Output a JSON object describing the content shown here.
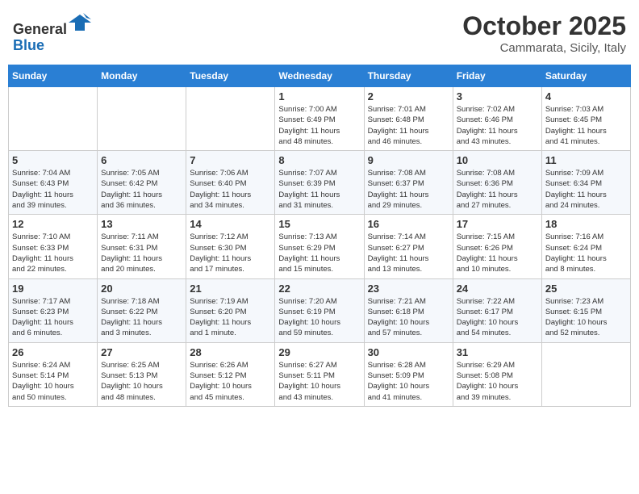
{
  "header": {
    "logo_line1": "General",
    "logo_line2": "Blue",
    "month": "October 2025",
    "location": "Cammarata, Sicily, Italy"
  },
  "weekdays": [
    "Sunday",
    "Monday",
    "Tuesday",
    "Wednesday",
    "Thursday",
    "Friday",
    "Saturday"
  ],
  "weeks": [
    [
      {
        "day": "",
        "info": ""
      },
      {
        "day": "",
        "info": ""
      },
      {
        "day": "",
        "info": ""
      },
      {
        "day": "1",
        "info": "Sunrise: 7:00 AM\nSunset: 6:49 PM\nDaylight: 11 hours\nand 48 minutes."
      },
      {
        "day": "2",
        "info": "Sunrise: 7:01 AM\nSunset: 6:48 PM\nDaylight: 11 hours\nand 46 minutes."
      },
      {
        "day": "3",
        "info": "Sunrise: 7:02 AM\nSunset: 6:46 PM\nDaylight: 11 hours\nand 43 minutes."
      },
      {
        "day": "4",
        "info": "Sunrise: 7:03 AM\nSunset: 6:45 PM\nDaylight: 11 hours\nand 41 minutes."
      }
    ],
    [
      {
        "day": "5",
        "info": "Sunrise: 7:04 AM\nSunset: 6:43 PM\nDaylight: 11 hours\nand 39 minutes."
      },
      {
        "day": "6",
        "info": "Sunrise: 7:05 AM\nSunset: 6:42 PM\nDaylight: 11 hours\nand 36 minutes."
      },
      {
        "day": "7",
        "info": "Sunrise: 7:06 AM\nSunset: 6:40 PM\nDaylight: 11 hours\nand 34 minutes."
      },
      {
        "day": "8",
        "info": "Sunrise: 7:07 AM\nSunset: 6:39 PM\nDaylight: 11 hours\nand 31 minutes."
      },
      {
        "day": "9",
        "info": "Sunrise: 7:08 AM\nSunset: 6:37 PM\nDaylight: 11 hours\nand 29 minutes."
      },
      {
        "day": "10",
        "info": "Sunrise: 7:08 AM\nSunset: 6:36 PM\nDaylight: 11 hours\nand 27 minutes."
      },
      {
        "day": "11",
        "info": "Sunrise: 7:09 AM\nSunset: 6:34 PM\nDaylight: 11 hours\nand 24 minutes."
      }
    ],
    [
      {
        "day": "12",
        "info": "Sunrise: 7:10 AM\nSunset: 6:33 PM\nDaylight: 11 hours\nand 22 minutes."
      },
      {
        "day": "13",
        "info": "Sunrise: 7:11 AM\nSunset: 6:31 PM\nDaylight: 11 hours\nand 20 minutes."
      },
      {
        "day": "14",
        "info": "Sunrise: 7:12 AM\nSunset: 6:30 PM\nDaylight: 11 hours\nand 17 minutes."
      },
      {
        "day": "15",
        "info": "Sunrise: 7:13 AM\nSunset: 6:29 PM\nDaylight: 11 hours\nand 15 minutes."
      },
      {
        "day": "16",
        "info": "Sunrise: 7:14 AM\nSunset: 6:27 PM\nDaylight: 11 hours\nand 13 minutes."
      },
      {
        "day": "17",
        "info": "Sunrise: 7:15 AM\nSunset: 6:26 PM\nDaylight: 11 hours\nand 10 minutes."
      },
      {
        "day": "18",
        "info": "Sunrise: 7:16 AM\nSunset: 6:24 PM\nDaylight: 11 hours\nand 8 minutes."
      }
    ],
    [
      {
        "day": "19",
        "info": "Sunrise: 7:17 AM\nSunset: 6:23 PM\nDaylight: 11 hours\nand 6 minutes."
      },
      {
        "day": "20",
        "info": "Sunrise: 7:18 AM\nSunset: 6:22 PM\nDaylight: 11 hours\nand 3 minutes."
      },
      {
        "day": "21",
        "info": "Sunrise: 7:19 AM\nSunset: 6:20 PM\nDaylight: 11 hours\nand 1 minute."
      },
      {
        "day": "22",
        "info": "Sunrise: 7:20 AM\nSunset: 6:19 PM\nDaylight: 10 hours\nand 59 minutes."
      },
      {
        "day": "23",
        "info": "Sunrise: 7:21 AM\nSunset: 6:18 PM\nDaylight: 10 hours\nand 57 minutes."
      },
      {
        "day": "24",
        "info": "Sunrise: 7:22 AM\nSunset: 6:17 PM\nDaylight: 10 hours\nand 54 minutes."
      },
      {
        "day": "25",
        "info": "Sunrise: 7:23 AM\nSunset: 6:15 PM\nDaylight: 10 hours\nand 52 minutes."
      }
    ],
    [
      {
        "day": "26",
        "info": "Sunrise: 6:24 AM\nSunset: 5:14 PM\nDaylight: 10 hours\nand 50 minutes."
      },
      {
        "day": "27",
        "info": "Sunrise: 6:25 AM\nSunset: 5:13 PM\nDaylight: 10 hours\nand 48 minutes."
      },
      {
        "day": "28",
        "info": "Sunrise: 6:26 AM\nSunset: 5:12 PM\nDaylight: 10 hours\nand 45 minutes."
      },
      {
        "day": "29",
        "info": "Sunrise: 6:27 AM\nSunset: 5:11 PM\nDaylight: 10 hours\nand 43 minutes."
      },
      {
        "day": "30",
        "info": "Sunrise: 6:28 AM\nSunset: 5:09 PM\nDaylight: 10 hours\nand 41 minutes."
      },
      {
        "day": "31",
        "info": "Sunrise: 6:29 AM\nSunset: 5:08 PM\nDaylight: 10 hours\nand 39 minutes."
      },
      {
        "day": "",
        "info": ""
      }
    ]
  ]
}
